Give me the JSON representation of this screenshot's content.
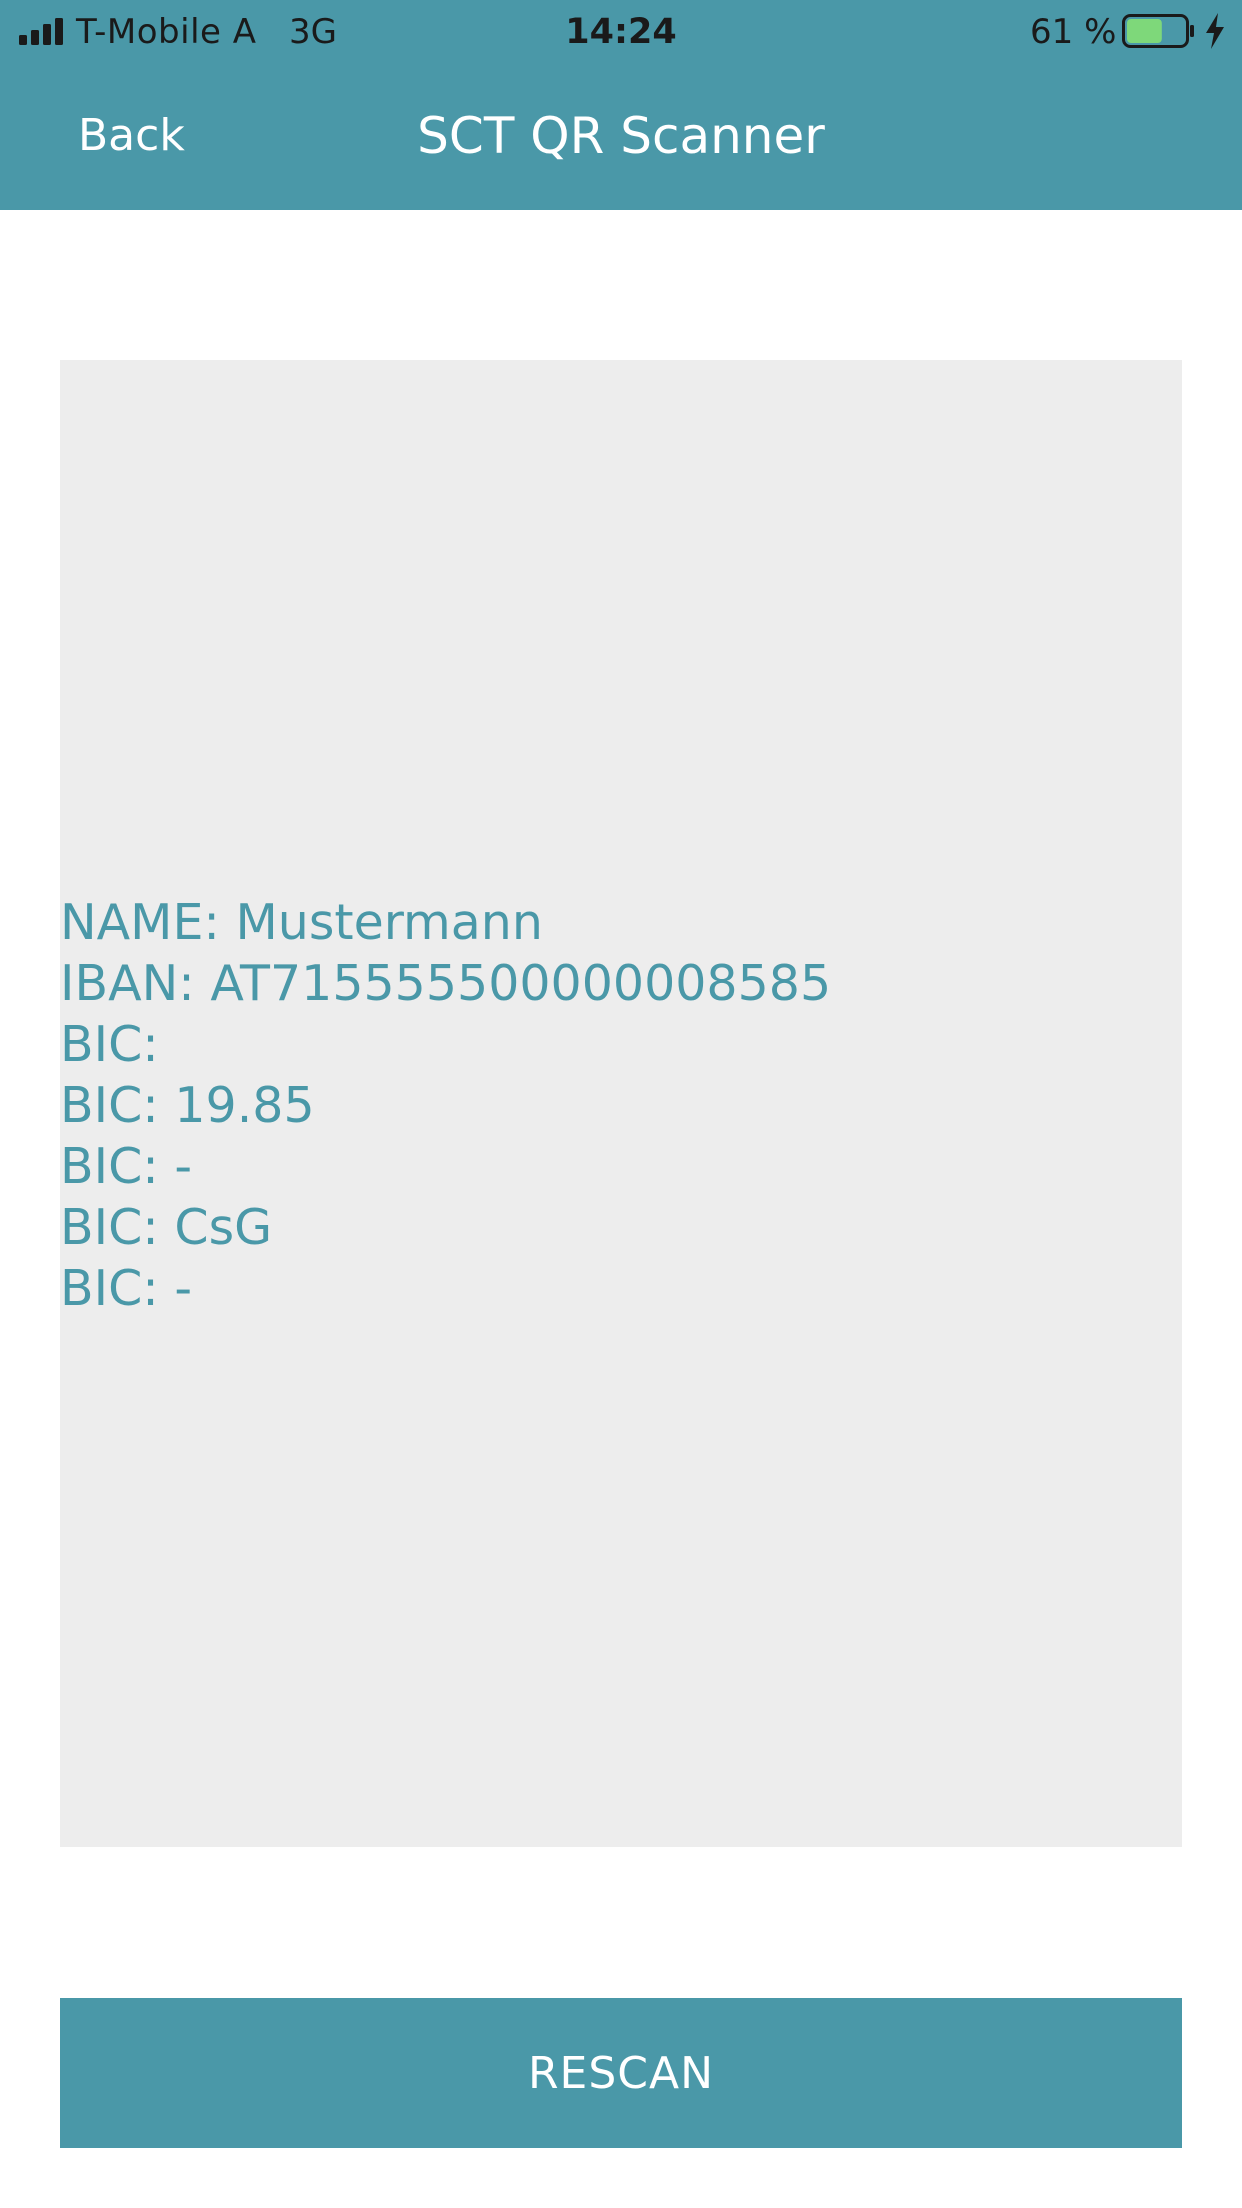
{
  "status_bar": {
    "carrier": "T-Mobile A",
    "network": "3G",
    "time": "14:24",
    "battery_percent": "61 %",
    "battery_level": 0.61,
    "battery_color": "#7ed87a",
    "signal_icon": "signal-bars-icon",
    "charging_icon": "charging-bolt-icon"
  },
  "nav": {
    "back_label": "Back",
    "title": "SCT QR Scanner",
    "color": "#4a98a8"
  },
  "scan_result": {
    "lines": [
      "NAME: Mustermann",
      "IBAN: AT715555500000008585",
      "BIC:",
      "BIC: 19.85",
      "BIC: -",
      "BIC: CsG",
      "BIC: -"
    ]
  },
  "actions": {
    "rescan_label": "RESCAN"
  }
}
